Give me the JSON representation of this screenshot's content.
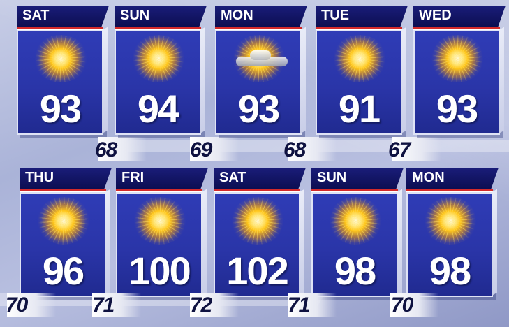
{
  "forecast": [
    {
      "day": "SAT",
      "high": "93",
      "low": "68",
      "icon": "sun-icon"
    },
    {
      "day": "SUN",
      "high": "94",
      "low": "69",
      "icon": "sun-icon"
    },
    {
      "day": "MON",
      "high": "93",
      "low": "68",
      "icon": "sun-cloud-icon"
    },
    {
      "day": "TUE",
      "high": "91",
      "low": "67",
      "icon": "sun-icon"
    },
    {
      "day": "WED",
      "high": "93",
      "low": "",
      "icon": "sun-icon"
    },
    {
      "day": "THU",
      "high": "96",
      "low": "70",
      "icon": "sun-icon"
    },
    {
      "day": "FRI",
      "high": "100",
      "low": "71",
      "icon": "sun-icon"
    },
    {
      "day": "SAT",
      "high": "102",
      "low": "72",
      "icon": "sun-icon"
    },
    {
      "day": "SUN",
      "high": "98",
      "low": "71",
      "icon": "sun-icon"
    },
    {
      "day": "MON",
      "high": "98",
      "low": "70",
      "icon": "sun-icon"
    }
  ],
  "colors": {
    "card": "#2f3cb6",
    "tab": "#12156a",
    "stripe": "#d32a2a",
    "low_text": "#0f1240"
  }
}
